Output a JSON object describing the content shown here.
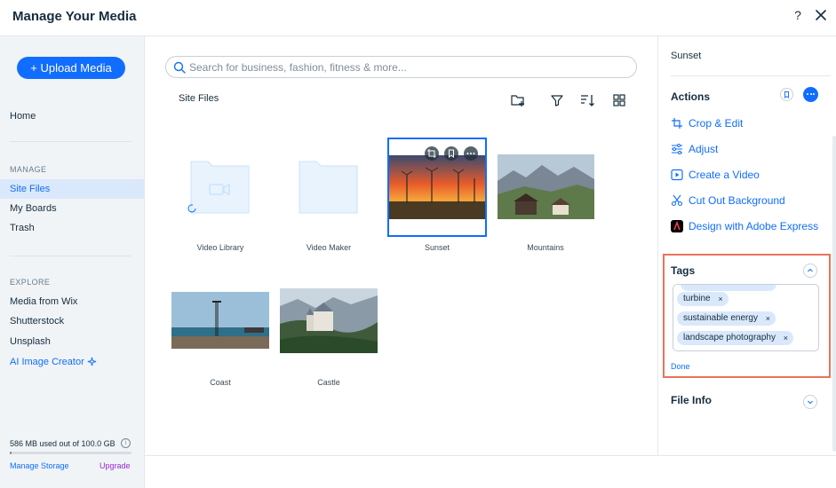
{
  "header": {
    "title": "Manage Your Media",
    "help_glyph": "?"
  },
  "sidebar": {
    "upload_label": "+ Upload Media",
    "home": "Home",
    "manage_section": "MANAGE",
    "manage_items": [
      "Site Files",
      "My Boards",
      "Trash"
    ],
    "explore_section": "EXPLORE",
    "explore_items": [
      "Media from Wix",
      "Shutterstock",
      "Unsplash"
    ],
    "ai_item": "AI Image Creator",
    "storage_text": "586 MB used out of 100.0 GB",
    "storage_used_fraction": 0.006,
    "manage_storage": "Manage Storage",
    "upgrade": "Upgrade"
  },
  "main": {
    "search_placeholder": "Search for business, fashion, fitness & more...",
    "breadcrumb": "Site Files",
    "items": [
      {
        "label": "Video Library",
        "kind": "folder"
      },
      {
        "label": "Video Maker",
        "kind": "folder"
      },
      {
        "label": "Sunset",
        "kind": "image",
        "selected": true
      },
      {
        "label": "Mountains",
        "kind": "image"
      },
      {
        "label": "Coast",
        "kind": "image"
      },
      {
        "label": "Castle",
        "kind": "image"
      }
    ]
  },
  "panel": {
    "file_name": "Sunset",
    "actions_title": "Actions",
    "actions": [
      "Crop & Edit",
      "Adjust",
      "Create a Video",
      "Cut Out Background",
      "Design with Adobe Express"
    ],
    "tags_title": "Tags",
    "tags": [
      "turbine",
      "sustainable energy",
      "landscape photography"
    ],
    "tag_remove_glyph": "×",
    "done": "Done",
    "file_info_title": "File Info"
  },
  "colors": {
    "accent": "#116dff",
    "highlight_border": "#e8735a",
    "upgrade": "#9a27d5"
  }
}
